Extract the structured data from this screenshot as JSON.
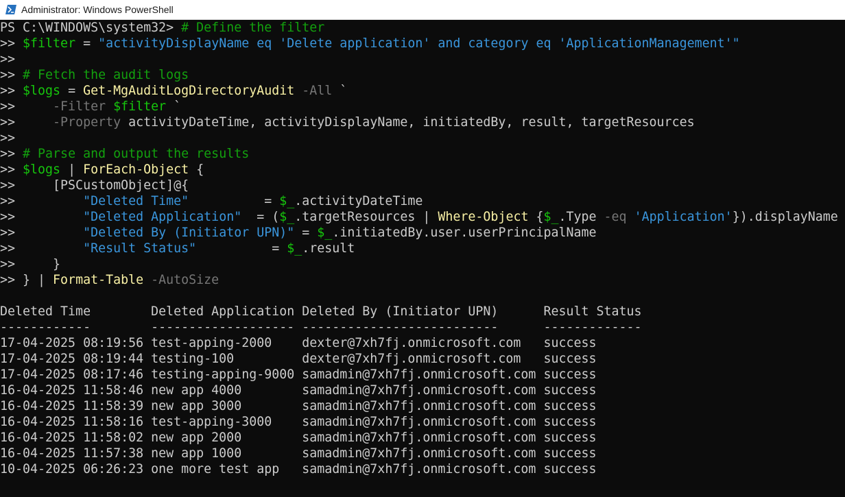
{
  "window": {
    "title": "Administrator: Windows PowerShell",
    "icon": "powershell-icon"
  },
  "script_lines": [
    [
      {
        "t": "PS C:\\WINDOWS\\system32> ",
        "c": "default"
      },
      {
        "t": "# Define the filter",
        "c": "comment"
      }
    ],
    [
      {
        "t": ">> ",
        "c": "default"
      },
      {
        "t": "$filter",
        "c": "var"
      },
      {
        "t": " = ",
        "c": "default"
      },
      {
        "t": "\"activityDisplayName eq 'Delete application' and category eq 'ApplicationManagement'\"",
        "c": "string"
      }
    ],
    [
      {
        "t": ">>",
        "c": "default"
      }
    ],
    [
      {
        "t": ">> ",
        "c": "default"
      },
      {
        "t": "# Fetch the audit logs",
        "c": "comment"
      }
    ],
    [
      {
        "t": ">> ",
        "c": "default"
      },
      {
        "t": "$logs",
        "c": "var"
      },
      {
        "t": " = ",
        "c": "default"
      },
      {
        "t": "Get-MgAuditLogDirectoryAudit",
        "c": "cmd"
      },
      {
        "t": " -All",
        "c": "param"
      },
      {
        "t": " `",
        "c": "default"
      }
    ],
    [
      {
        "t": ">>     ",
        "c": "default"
      },
      {
        "t": "-Filter",
        "c": "param"
      },
      {
        "t": " ",
        "c": "default"
      },
      {
        "t": "$filter",
        "c": "var"
      },
      {
        "t": " `",
        "c": "default"
      }
    ],
    [
      {
        "t": ">>     ",
        "c": "default"
      },
      {
        "t": "-Property",
        "c": "param"
      },
      {
        "t": " activityDateTime, activityDisplayName, initiatedBy, result, targetResources",
        "c": "default"
      }
    ],
    [
      {
        "t": ">>",
        "c": "default"
      }
    ],
    [
      {
        "t": ">> ",
        "c": "default"
      },
      {
        "t": "# Parse and output the results",
        "c": "comment"
      }
    ],
    [
      {
        "t": ">> ",
        "c": "default"
      },
      {
        "t": "$logs",
        "c": "var"
      },
      {
        "t": " | ",
        "c": "default"
      },
      {
        "t": "ForEach-Object",
        "c": "cmd"
      },
      {
        "t": " {",
        "c": "default"
      }
    ],
    [
      {
        "t": ">>     [PSCustomObject]@{",
        "c": "default"
      }
    ],
    [
      {
        "t": ">>         ",
        "c": "default"
      },
      {
        "t": "\"Deleted Time\"",
        "c": "string"
      },
      {
        "t": "          = ",
        "c": "default"
      },
      {
        "t": "$_",
        "c": "var"
      },
      {
        "t": ".activityDateTime",
        "c": "default"
      }
    ],
    [
      {
        "t": ">>         ",
        "c": "default"
      },
      {
        "t": "\"Deleted Application\"",
        "c": "string"
      },
      {
        "t": "  = (",
        "c": "default"
      },
      {
        "t": "$_",
        "c": "var"
      },
      {
        "t": ".targetResources | ",
        "c": "default"
      },
      {
        "t": "Where-Object",
        "c": "cmd"
      },
      {
        "t": " {",
        "c": "default"
      },
      {
        "t": "$_",
        "c": "var"
      },
      {
        "t": ".Type ",
        "c": "default"
      },
      {
        "t": "-eq",
        "c": "param"
      },
      {
        "t": " ",
        "c": "default"
      },
      {
        "t": "'Application'",
        "c": "string"
      },
      {
        "t": "}).displayName",
        "c": "default"
      }
    ],
    [
      {
        "t": ">>         ",
        "c": "default"
      },
      {
        "t": "\"Deleted By (Initiator UPN)\"",
        "c": "string"
      },
      {
        "t": " = ",
        "c": "default"
      },
      {
        "t": "$_",
        "c": "var"
      },
      {
        "t": ".initiatedBy.user.userPrincipalName",
        "c": "default"
      }
    ],
    [
      {
        "t": ">>         ",
        "c": "default"
      },
      {
        "t": "\"Result Status\"",
        "c": "string"
      },
      {
        "t": "          = ",
        "c": "default"
      },
      {
        "t": "$_",
        "c": "var"
      },
      {
        "t": ".result",
        "c": "default"
      }
    ],
    [
      {
        "t": ">>     }",
        "c": "default"
      }
    ],
    [
      {
        "t": ">> } | ",
        "c": "default"
      },
      {
        "t": "Format-Table",
        "c": "cmd"
      },
      {
        "t": " -AutoSize",
        "c": "param"
      }
    ]
  ],
  "table": {
    "headers": [
      "Deleted Time",
      "Deleted Application",
      "Deleted By (Initiator UPN)",
      "Result Status"
    ],
    "separators": [
      "------------",
      "-------------------",
      "--------------------------",
      "-------------"
    ],
    "rows": [
      [
        "17-04-2025 08:19:56",
        "test-apping-2000",
        "dexter@7xh7fj.onmicrosoft.com",
        "success"
      ],
      [
        "17-04-2025 08:19:44",
        "testing-100",
        "dexter@7xh7fj.onmicrosoft.com",
        "success"
      ],
      [
        "17-04-2025 08:17:46",
        "testing-apping-9000",
        "samadmin@7xh7fj.onmicrosoft.com",
        "success"
      ],
      [
        "16-04-2025 11:58:46",
        "new app 4000",
        "samadmin@7xh7fj.onmicrosoft.com",
        "success"
      ],
      [
        "16-04-2025 11:58:39",
        "new app 3000",
        "samadmin@7xh7fj.onmicrosoft.com",
        "success"
      ],
      [
        "16-04-2025 11:58:16",
        "test-apping-3000",
        "samadmin@7xh7fj.onmicrosoft.com",
        "success"
      ],
      [
        "16-04-2025 11:58:02",
        "new app 2000",
        "samadmin@7xh7fj.onmicrosoft.com",
        "success"
      ],
      [
        "16-04-2025 11:57:38",
        "new app 1000",
        "samadmin@7xh7fj.onmicrosoft.com",
        "success"
      ],
      [
        "10-04-2025 06:26:23",
        "one more test app",
        "samadmin@7xh7fj.onmicrosoft.com",
        "success"
      ]
    ]
  },
  "colors": {
    "background": "#0c0c0c",
    "text": "#cccccc",
    "comment": "#13a10e",
    "variable": "#16c60c",
    "string": "#3a96dd",
    "command": "#f9f1a5",
    "parameter": "#767676"
  }
}
